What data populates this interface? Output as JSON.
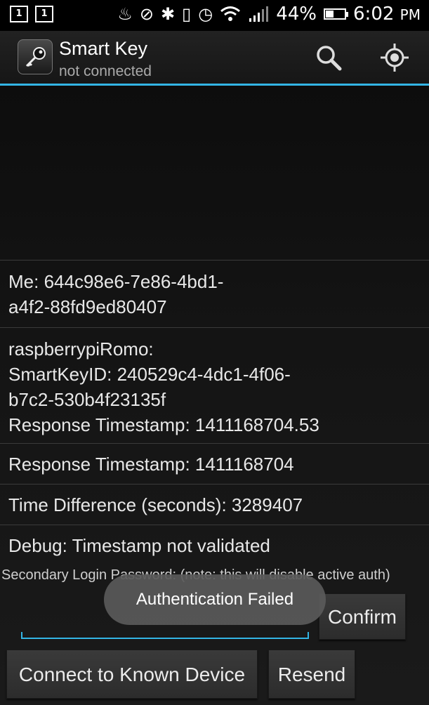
{
  "status_bar": {
    "battery_percent": "44%",
    "battery_level": 0.44,
    "time": "6:02",
    "time_suffix": "PM",
    "left_icons": [
      "1",
      "1"
    ],
    "icons": [
      "fire-icon",
      "sync-off-icon",
      "bluetooth-icon",
      "vibrate-icon",
      "alarm-icon",
      "wifi-icon",
      "signal-icon",
      "battery-icon"
    ]
  },
  "action_bar": {
    "title": "Smart Key",
    "subtitle": "not connected",
    "search_icon": "search-icon",
    "locate_icon": "gps-locate-icon",
    "accent": "#33b5e5"
  },
  "list": [
    {
      "lines": [
        "Me:  644c98e6-7e86-4bd1-",
        "a4f2-88fd9ed80407"
      ]
    },
    {
      "lines": [
        "raspberrypiRomo:",
        "SmartKeyID: 240529c4-4dc1-4f06-",
        "b7c2-530b4f23135f",
        "Response Timestamp: 1411168704.53"
      ]
    },
    {
      "lines": [
        "Response Timestamp: 1411168704"
      ]
    },
    {
      "lines": [
        "Time Difference (seconds): 3289407"
      ]
    },
    {
      "lines": [
        "Debug: Timestamp not validated"
      ]
    }
  ],
  "secondary_label": "Secondary Login Password: (note: this will disable active auth)",
  "password_input": {
    "value": "",
    "placeholder": ""
  },
  "buttons": {
    "confirm": "Confirm",
    "connect": "Connect to Known Device",
    "resend": "Resend"
  },
  "toast": "Authentication Failed"
}
